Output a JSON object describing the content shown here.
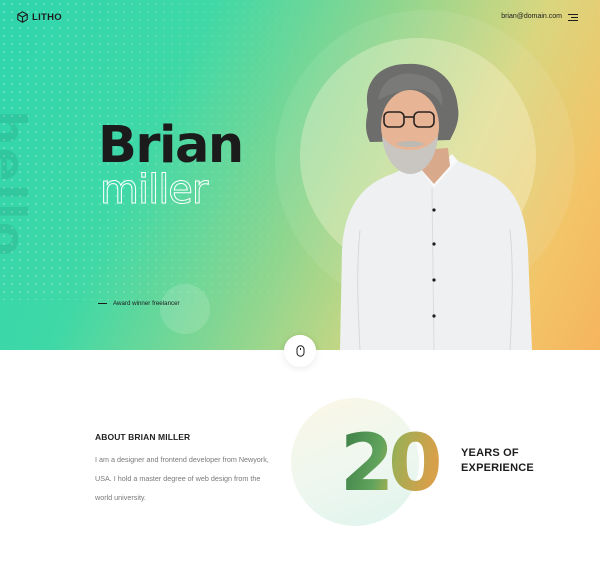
{
  "header": {
    "logo_text": "LITHO",
    "email": "brian@domain.com"
  },
  "hero": {
    "first_name": "Brian",
    "last_name": "miller",
    "vertical_text": "hello",
    "tagline": "Award winner freelancer"
  },
  "about": {
    "title": "ABOUT BRIAN MILLER",
    "text": "I am a designer and frontend developer from Newyork, USA. I hold a master degree of web design from the world university."
  },
  "experience": {
    "number": "20",
    "label_line1": "YEARS OF",
    "label_line2": "EXPERIENCE"
  },
  "icons": {
    "logo": "cube-icon",
    "menu": "hamburger-menu-icon",
    "scroll": "mouse-scroll-icon"
  },
  "colors": {
    "gradient_start": "#2fd5ad",
    "gradient_mid": "#8fd68f",
    "gradient_end": "#f5b55e",
    "text_dark": "#1c1c1c",
    "text_muted": "#7a7a7a"
  }
}
